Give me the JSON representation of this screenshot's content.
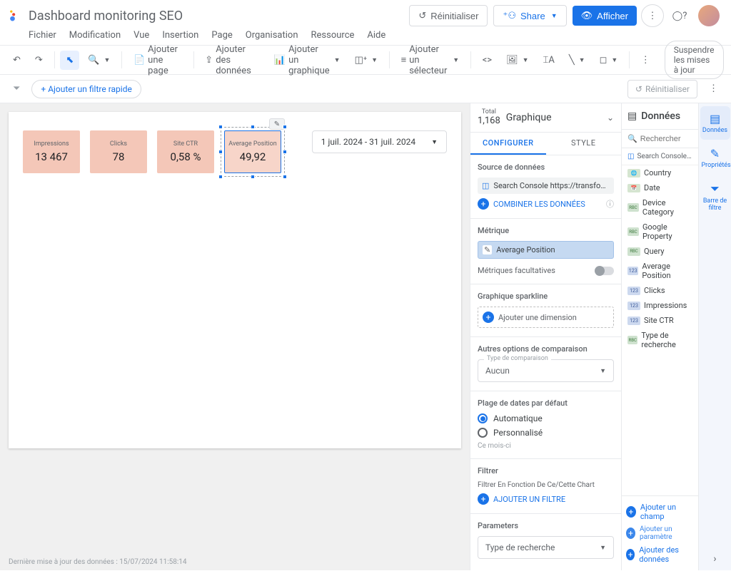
{
  "header": {
    "title": "Dashboard monitoring SEO",
    "reset": "Réinitialiser",
    "share": "Share",
    "view": "Afficher"
  },
  "menu": {
    "file": "Fichier",
    "edit": "Modification",
    "view": "Vue",
    "insert": "Insertion",
    "page": "Page",
    "arrange": "Organisation",
    "resource": "Ressource",
    "help": "Aide"
  },
  "toolbar": {
    "add_page": "Ajouter une page",
    "add_data": "Ajouter des données",
    "add_chart": "Ajouter un graphique",
    "add_selector": "Ajouter un sélecteur",
    "suspend": "Suspendre les mises à jour"
  },
  "filterbar": {
    "add_quick": "+ Ajouter un filtre rapide",
    "reset": "Réinitialiser"
  },
  "canvas": {
    "date_range": "1 juil. 2024 - 31 juil. 2024",
    "last_update": "Dernière mise à jour des données : 15/07/2024 11:58:14",
    "cards": [
      {
        "label": "Impressions",
        "value": "13 467"
      },
      {
        "label": "Clicks",
        "value": "78"
      },
      {
        "label": "Site CTR",
        "value": "0,58 %"
      },
      {
        "label": "Average Position",
        "value": "49,92"
      }
    ]
  },
  "config": {
    "total_label": "Total",
    "total_value": "1,168",
    "chart_type": "Graphique",
    "tab_configure": "CONFIGURER",
    "tab_style": "STYLE",
    "ds_title": "Source de données",
    "ds_name": "Search Console https://transfonumerique.fr/",
    "combine": "COMBINER LES DONNÉES",
    "metric_title": "Métrique",
    "metric": "Average Position",
    "fac": "Métriques facultatives",
    "spark_title": "Graphique sparkline",
    "spark_add": "Ajouter une dimension",
    "compare_title": "Autres options de comparaison",
    "compare_legend": "Type de comparaison",
    "compare_val": "Aucun",
    "range_title": "Plage de dates par défaut",
    "auto": "Automatique",
    "custom": "Personnalisé",
    "range_hint": "Ce mois-ci",
    "filter_title": "Filtrer",
    "filter_sub": "Filtrer En Fonction De Ce/Cette Chart",
    "filter_add": "AJOUTER UN FILTRE",
    "params_title": "Parameters",
    "param_val": "Type de recherche"
  },
  "data": {
    "title": "Données",
    "search_ph": "Rechercher",
    "source": "Search Console https:...",
    "fields": [
      {
        "t": "geo",
        "n": "Country"
      },
      {
        "t": "date",
        "n": "Date"
      },
      {
        "t": "dim",
        "n": "Device Category"
      },
      {
        "t": "dim",
        "n": "Google Property"
      },
      {
        "t": "dim",
        "n": "Query"
      },
      {
        "t": "num",
        "n": "Average Position"
      },
      {
        "t": "num",
        "n": "Clicks"
      },
      {
        "t": "num",
        "n": "Impressions"
      },
      {
        "t": "num",
        "n": "Site CTR"
      },
      {
        "t": "dim",
        "n": "Type de recherche"
      }
    ],
    "add_field": "Ajouter un champ",
    "add_param": "Ajouter un paramètre",
    "add_data": "Ajouter des données"
  },
  "rail": {
    "data": "Données",
    "props": "Propriétés",
    "filter": "Barre de filtre"
  }
}
